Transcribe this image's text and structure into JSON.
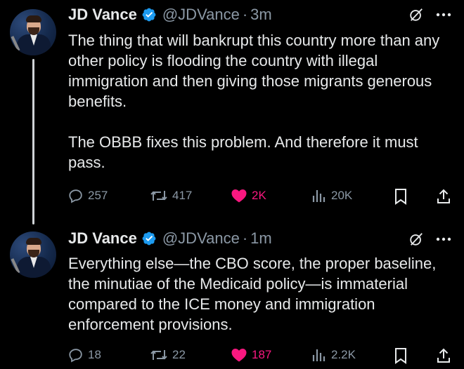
{
  "colors": {
    "background": "#000000",
    "text": "#e7e9ea",
    "muted": "#8b98a5",
    "like": "#f91880",
    "verified": "#1d9bf0"
  },
  "tweets": [
    {
      "name": "JD Vance",
      "handle": "@JDVance",
      "separator": "·",
      "time": "3m",
      "paragraphs": [
        "The thing that will bankrupt this country more than any other policy is flooding the country with illegal immigration and then giving those migrants generous benefits.",
        "The OBBB fixes this problem. And therefore it must pass."
      ],
      "replies": "257",
      "reposts": "417",
      "likes": "2K",
      "views": "20K",
      "liked": true
    },
    {
      "name": "JD Vance",
      "handle": "@JDVance",
      "separator": "·",
      "time": "1m",
      "paragraphs": [
        "Everything else—the CBO score, the proper baseline, the minutiae of the Medicaid policy—is immaterial compared to the ICE money and immigration enforcement provisions."
      ],
      "replies": "18",
      "reposts": "22",
      "likes": "187",
      "views": "2.2K",
      "liked": true
    }
  ],
  "icons": [
    "verified-badge-icon",
    "grok-icon",
    "more-icon",
    "reply-icon",
    "repost-icon",
    "like-icon",
    "views-icon",
    "bookmark-icon",
    "share-icon"
  ]
}
